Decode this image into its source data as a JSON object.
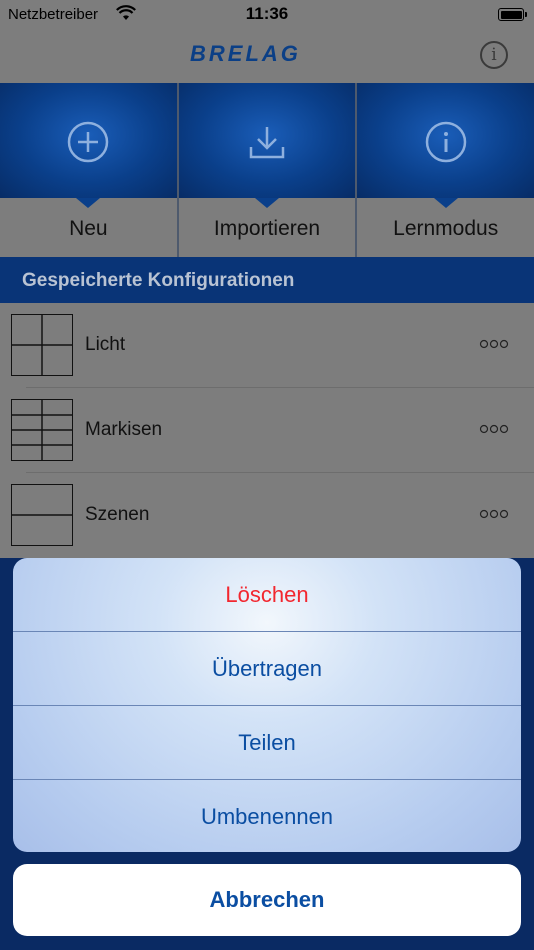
{
  "status_bar": {
    "carrier": "Netzbetreiber",
    "time": "11:36",
    "icons": [
      "wifi-icon",
      "battery-icon"
    ]
  },
  "nav": {
    "logo": "BRELAG",
    "info_icon": "info-icon"
  },
  "tiles": [
    {
      "label": "Neu",
      "icon": "plus-circle-icon"
    },
    {
      "label": "Importieren",
      "icon": "download-icon"
    },
    {
      "label": "Lernmodus",
      "icon": "info-circle-icon"
    }
  ],
  "section_title": "Gespeicherte Konfigurationen",
  "configurations": [
    {
      "name": "Licht",
      "layout": "2x2-grid"
    },
    {
      "name": "Markisen",
      "layout": "2x4-grid"
    },
    {
      "name": "Szenen",
      "layout": "1x2-grid"
    }
  ],
  "more_icon": "ellipsis-circles-icon",
  "action_sheet": {
    "actions": [
      {
        "label": "Löschen",
        "style": "destructive",
        "color": "#f2272f"
      },
      {
        "label": "Übertragen",
        "style": "default",
        "color": "#0b4ea2"
      },
      {
        "label": "Teilen",
        "style": "default",
        "color": "#0b4ea2"
      },
      {
        "label": "Umbenennen",
        "style": "default",
        "color": "#0b4ea2"
      }
    ],
    "cancel": "Abbrechen"
  },
  "colors": {
    "brand_blue": "#093477",
    "overlay_gray": "#7d7d7d",
    "action_blue": "#0b4ea2",
    "destructive_red": "#f2272f"
  }
}
